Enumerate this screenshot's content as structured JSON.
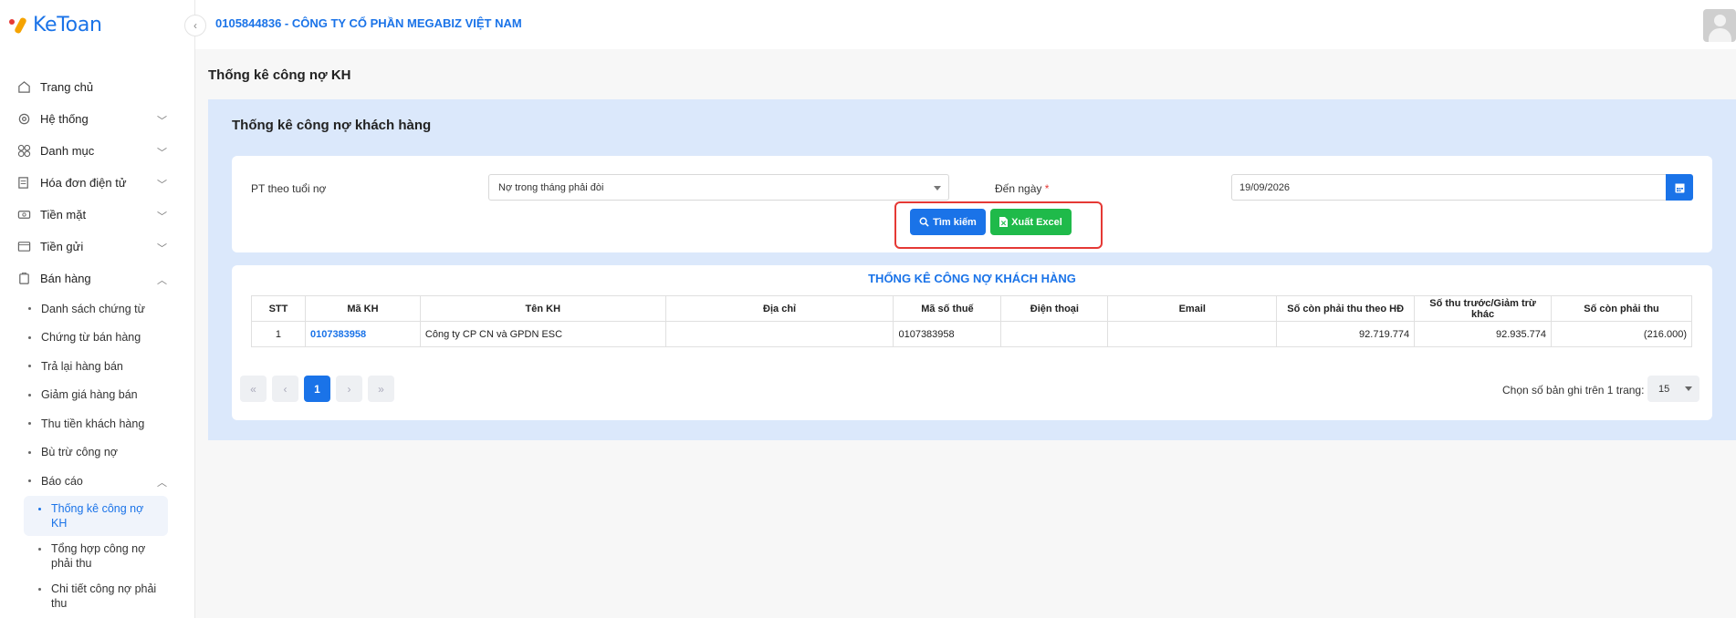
{
  "app": {
    "logo_text": "KeToan"
  },
  "header": {
    "company": "0105844836 - CÔNG TY CỔ PHẦN MEGABIZ VIỆT NAM"
  },
  "sidebar": {
    "items": [
      {
        "label": "Trang chủ",
        "icon": "home-icon"
      },
      {
        "label": "Hệ thống",
        "icon": "settings-icon"
      },
      {
        "label": "Danh mục",
        "icon": "grid-icon"
      },
      {
        "label": "Hóa đơn điện tử",
        "icon": "invoice-icon"
      },
      {
        "label": "Tiền mặt",
        "icon": "cash-icon"
      },
      {
        "label": "Tiền gửi",
        "icon": "bank-icon"
      },
      {
        "label": "Bán hàng",
        "icon": "sales-icon"
      }
    ],
    "sub_items": [
      "Danh sách chứng từ",
      "Chứng từ bán hàng",
      "Trả lại hàng bán",
      "Giảm giá hàng bán",
      "Thu tiền khách hàng",
      "Bù trừ công nợ",
      "Báo cáo"
    ],
    "report_items": [
      "Thống kê công nợ KH",
      "Tổng hợp công nợ phải thu",
      "Chi tiết công nợ phải thu"
    ]
  },
  "page": {
    "title": "Thống kê công nợ KH",
    "panel_title": "Thống kê công nợ khách hàng"
  },
  "filter": {
    "age_label": "PT theo tuổi nợ",
    "age_value": "Nợ trong tháng phải đòi",
    "date_label": "Đến ngày",
    "date_required": "*",
    "date_value": "19/09/2026",
    "search_label": "Tìm kiếm",
    "excel_label": "Xuất Excel"
  },
  "table": {
    "title": "THỐNG KÊ CÔNG NỢ KHÁCH HÀNG",
    "headers": [
      "STT",
      "Mã KH",
      "Tên KH",
      "Địa chỉ",
      "Mã số thuế",
      "Điện thoại",
      "Email",
      "Số còn phải thu theo HĐ",
      "Số thu trước/Giảm trừ khác",
      "Số còn phải thu"
    ],
    "rows": [
      [
        "1",
        "0107383958",
        "Công ty CP CN và GPDN ESC",
        "",
        "0107383958",
        "",
        "",
        "92.719.774",
        "92.935.774",
        "(216.000)"
      ]
    ]
  },
  "pagination": {
    "current_page": "1",
    "rows_label": "Chọn số bản ghi trên 1 trang:",
    "rows_value": "15"
  },
  "colors": {
    "accent": "#1a73e8",
    "excel": "#1fba4a",
    "highlight": "#e53935",
    "panel": "#dbe8fb"
  }
}
